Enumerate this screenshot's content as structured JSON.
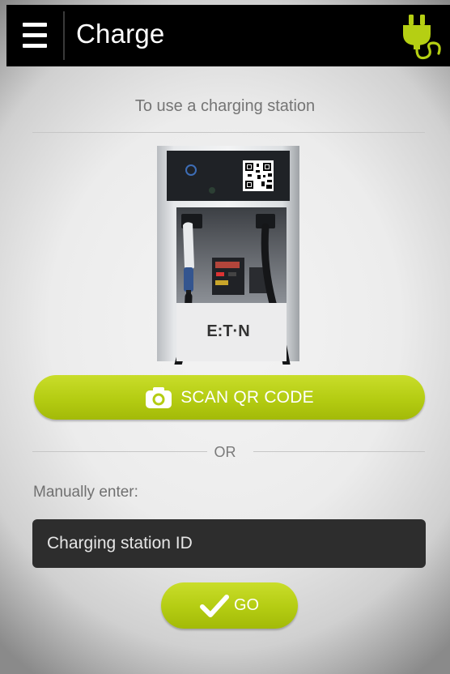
{
  "header": {
    "title": "Charge",
    "menu_icon": "hamburger-menu-icon",
    "plug_icon": "ev-plug-icon",
    "accent_color": "#b5cf13"
  },
  "main": {
    "section_title": "To use a charging station",
    "station_image": {
      "brand_text": "E:T·N"
    },
    "scan_button": {
      "label": "SCAN QR CODE",
      "icon": "camera-icon"
    },
    "divider_text": "OR",
    "manual_label": "Manually enter:",
    "station_input": {
      "placeholder": "Charging station ID",
      "value": ""
    },
    "go_button": {
      "label": "GO",
      "icon": "checkmark-icon"
    }
  },
  "colors": {
    "header_bg": "#000000",
    "button_green": "#b5cf13",
    "input_bg": "#2d2d2d",
    "muted_text": "#757575"
  }
}
